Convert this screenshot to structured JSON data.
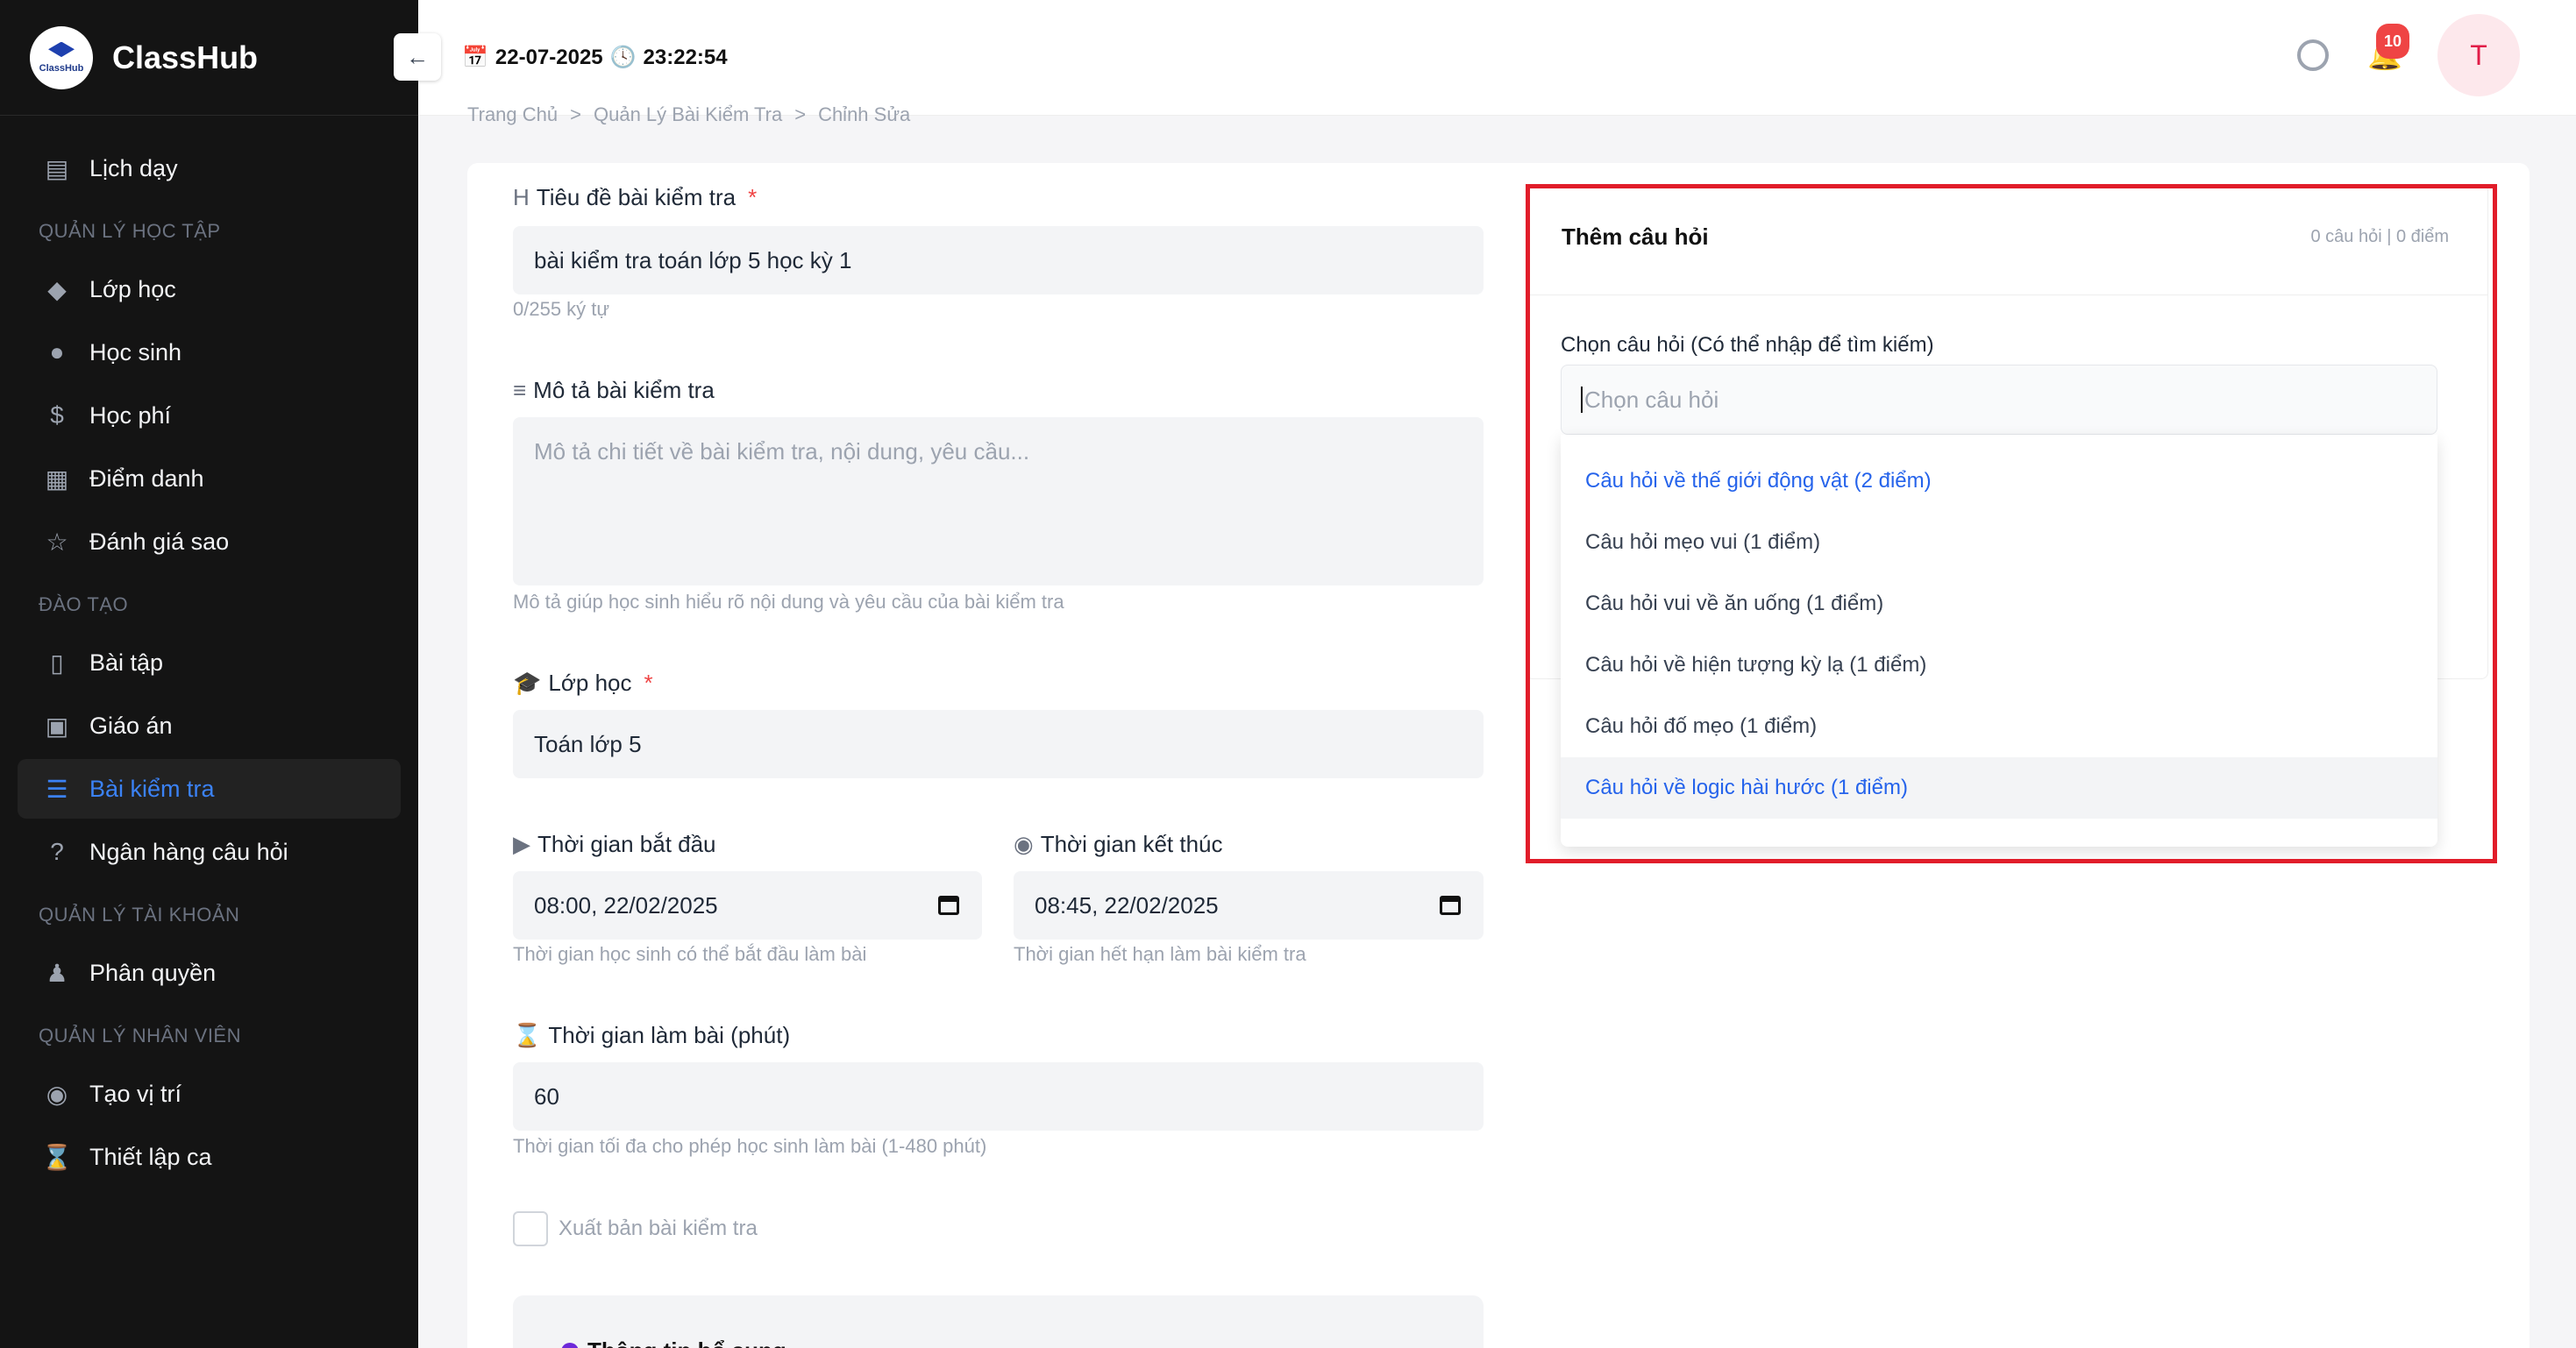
{
  "brand": {
    "name": "ClassHub",
    "logo_text": "ClassHub"
  },
  "header": {
    "date": "22-07-2025",
    "time": "23:22:54",
    "notification_count": "10",
    "avatar_initial": "T"
  },
  "sidebar": {
    "top_item": "Lịch dạy",
    "sections": [
      {
        "title": "QUẢN LÝ HỌC TẬP",
        "items": [
          "Lớp học",
          "Học sinh",
          "Học phí",
          "Điểm danh",
          "Đánh giá sao"
        ]
      },
      {
        "title": "ĐÀO TẠO",
        "items": [
          "Bài tập",
          "Giáo án",
          "Bài kiểm tra",
          "Ngân hàng câu hỏi"
        ]
      },
      {
        "title": "QUẢN LÝ TÀI KHOẢN",
        "items": [
          "Phân quyền"
        ]
      },
      {
        "title": "QUẢN LÝ NHÂN VIÊN",
        "items": [
          "Tạo vị trí",
          "Thiết lập ca"
        ]
      }
    ]
  },
  "breadcrumb": [
    "Trang Chủ",
    "Quản Lý Bài Kiểm Tra",
    "Chỉnh Sửa"
  ],
  "form": {
    "title_label": "Tiêu đề bài kiểm tra",
    "title_value": "bài kiểm tra toán lớp 5 học kỳ 1",
    "title_counter": "0/255 ký tự",
    "desc_label": "Mô tả bài kiểm tra",
    "desc_placeholder": "Mô tả chi tiết về bài kiểm tra, nội dung, yêu cầu...",
    "desc_hint": "Mô tả giúp học sinh hiểu rõ nội dung và yêu cầu của bài kiểm tra",
    "class_label": "Lớp học",
    "class_value": "Toán lớp 5",
    "start_label": "Thời gian bắt đầu",
    "start_value": "08:00, 22/02/2025",
    "start_hint": "Thời gian học sinh có thể bắt đầu làm bài",
    "end_label": "Thời gian kết thúc",
    "end_value": "08:45, 22/02/2025",
    "end_hint": "Thời gian hết hạn làm bài kiểm tra",
    "duration_label": "Thời gian làm bài (phút)",
    "duration_value": "60",
    "duration_hint": "Thời gian tối đa cho phép học sinh làm bài (1-480 phút)",
    "publish_label": "Xuất bản bài kiểm tra",
    "extra_info_title": "Thông tin bổ sung"
  },
  "questions": {
    "title": "Thêm câu hỏi",
    "stats": "0 câu hỏi | 0 điểm",
    "select_label": "Chọn câu hỏi (Có thể nhập để tìm kiếm)",
    "select_placeholder": "Chọn câu hỏi",
    "options": [
      "Câu hỏi về thế giới động vật (2 điểm)",
      "Câu hỏi mẹo vui (1 điểm)",
      "Câu hỏi vui về ăn uống (1 điểm)",
      "Câu hỏi về hiện tượng kỳ lạ (1 điểm)",
      "Câu hỏi đố mẹo (1 điểm)",
      "Câu hỏi về logic hài hước (1 điểm)"
    ]
  },
  "colors": {
    "accent": "#2563eb",
    "sidebar_bg": "#141414",
    "highlight": "#e11d2a"
  }
}
